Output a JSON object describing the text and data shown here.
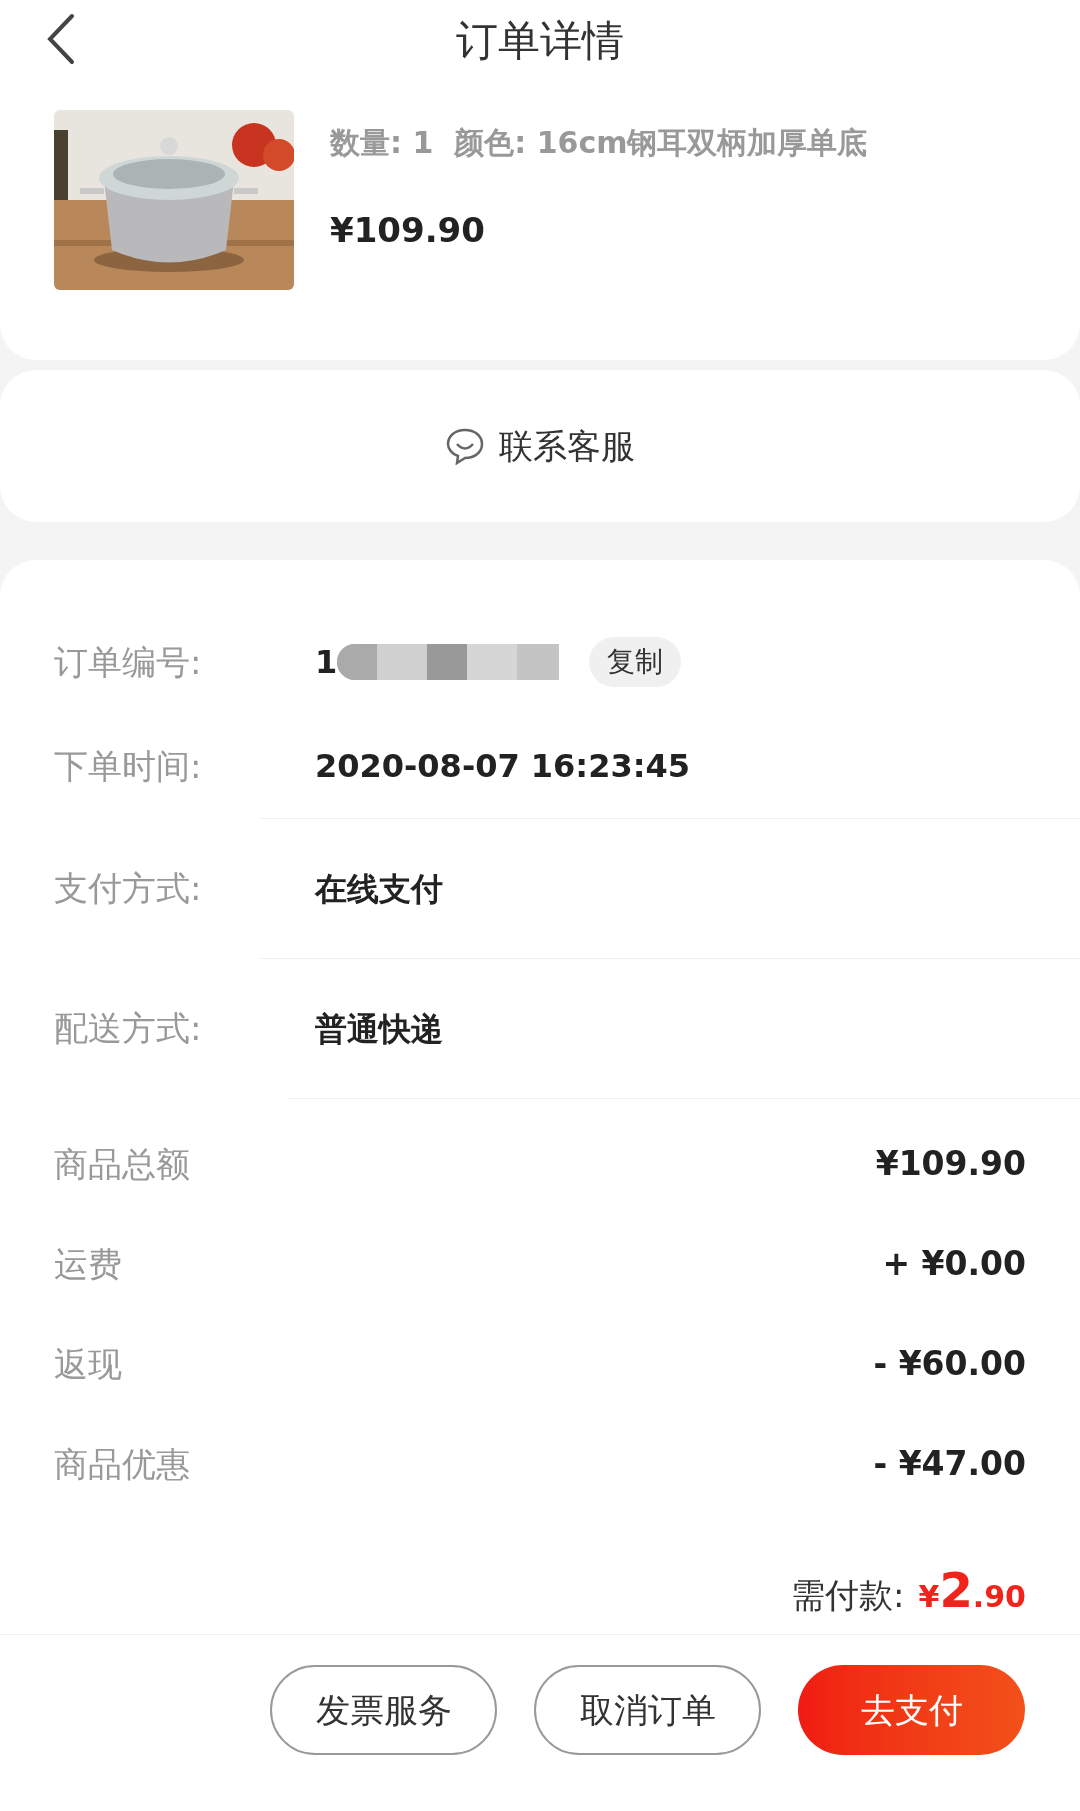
{
  "header": {
    "title": "订单详情"
  },
  "product": {
    "spec": "数量: 1  颜色: 16cm钢耳双柄加厚单底",
    "price": "¥109.90"
  },
  "contact": {
    "label": "联系客服"
  },
  "order_info": [
    {
      "label": "订单编号:",
      "value": "1",
      "redacted": true,
      "action": "复制"
    },
    {
      "label": "下单时间:",
      "value": "2020-08-07 16:23:45",
      "redacted": false
    },
    {
      "label": "支付方式:",
      "value": "在线支付",
      "redacted": false
    },
    {
      "label": "配送方式:",
      "value": "普通快递",
      "redacted": false
    }
  ],
  "summary": [
    {
      "label": "商品总额",
      "value": "¥109.90"
    },
    {
      "label": "运费",
      "value": "+ ¥0.00"
    },
    {
      "label": "返现",
      "value": "- ¥60.00"
    },
    {
      "label": "商品优惠",
      "value": "- ¥47.00"
    }
  ],
  "total": {
    "label": "需付款:",
    "currency": "¥",
    "integer": "2",
    "decimal": ".90"
  },
  "buttons": [
    {
      "label": "发票服务",
      "kind": "outline"
    },
    {
      "label": "取消订单",
      "kind": "outline"
    },
    {
      "label": "去支付",
      "kind": "primary"
    }
  ]
}
